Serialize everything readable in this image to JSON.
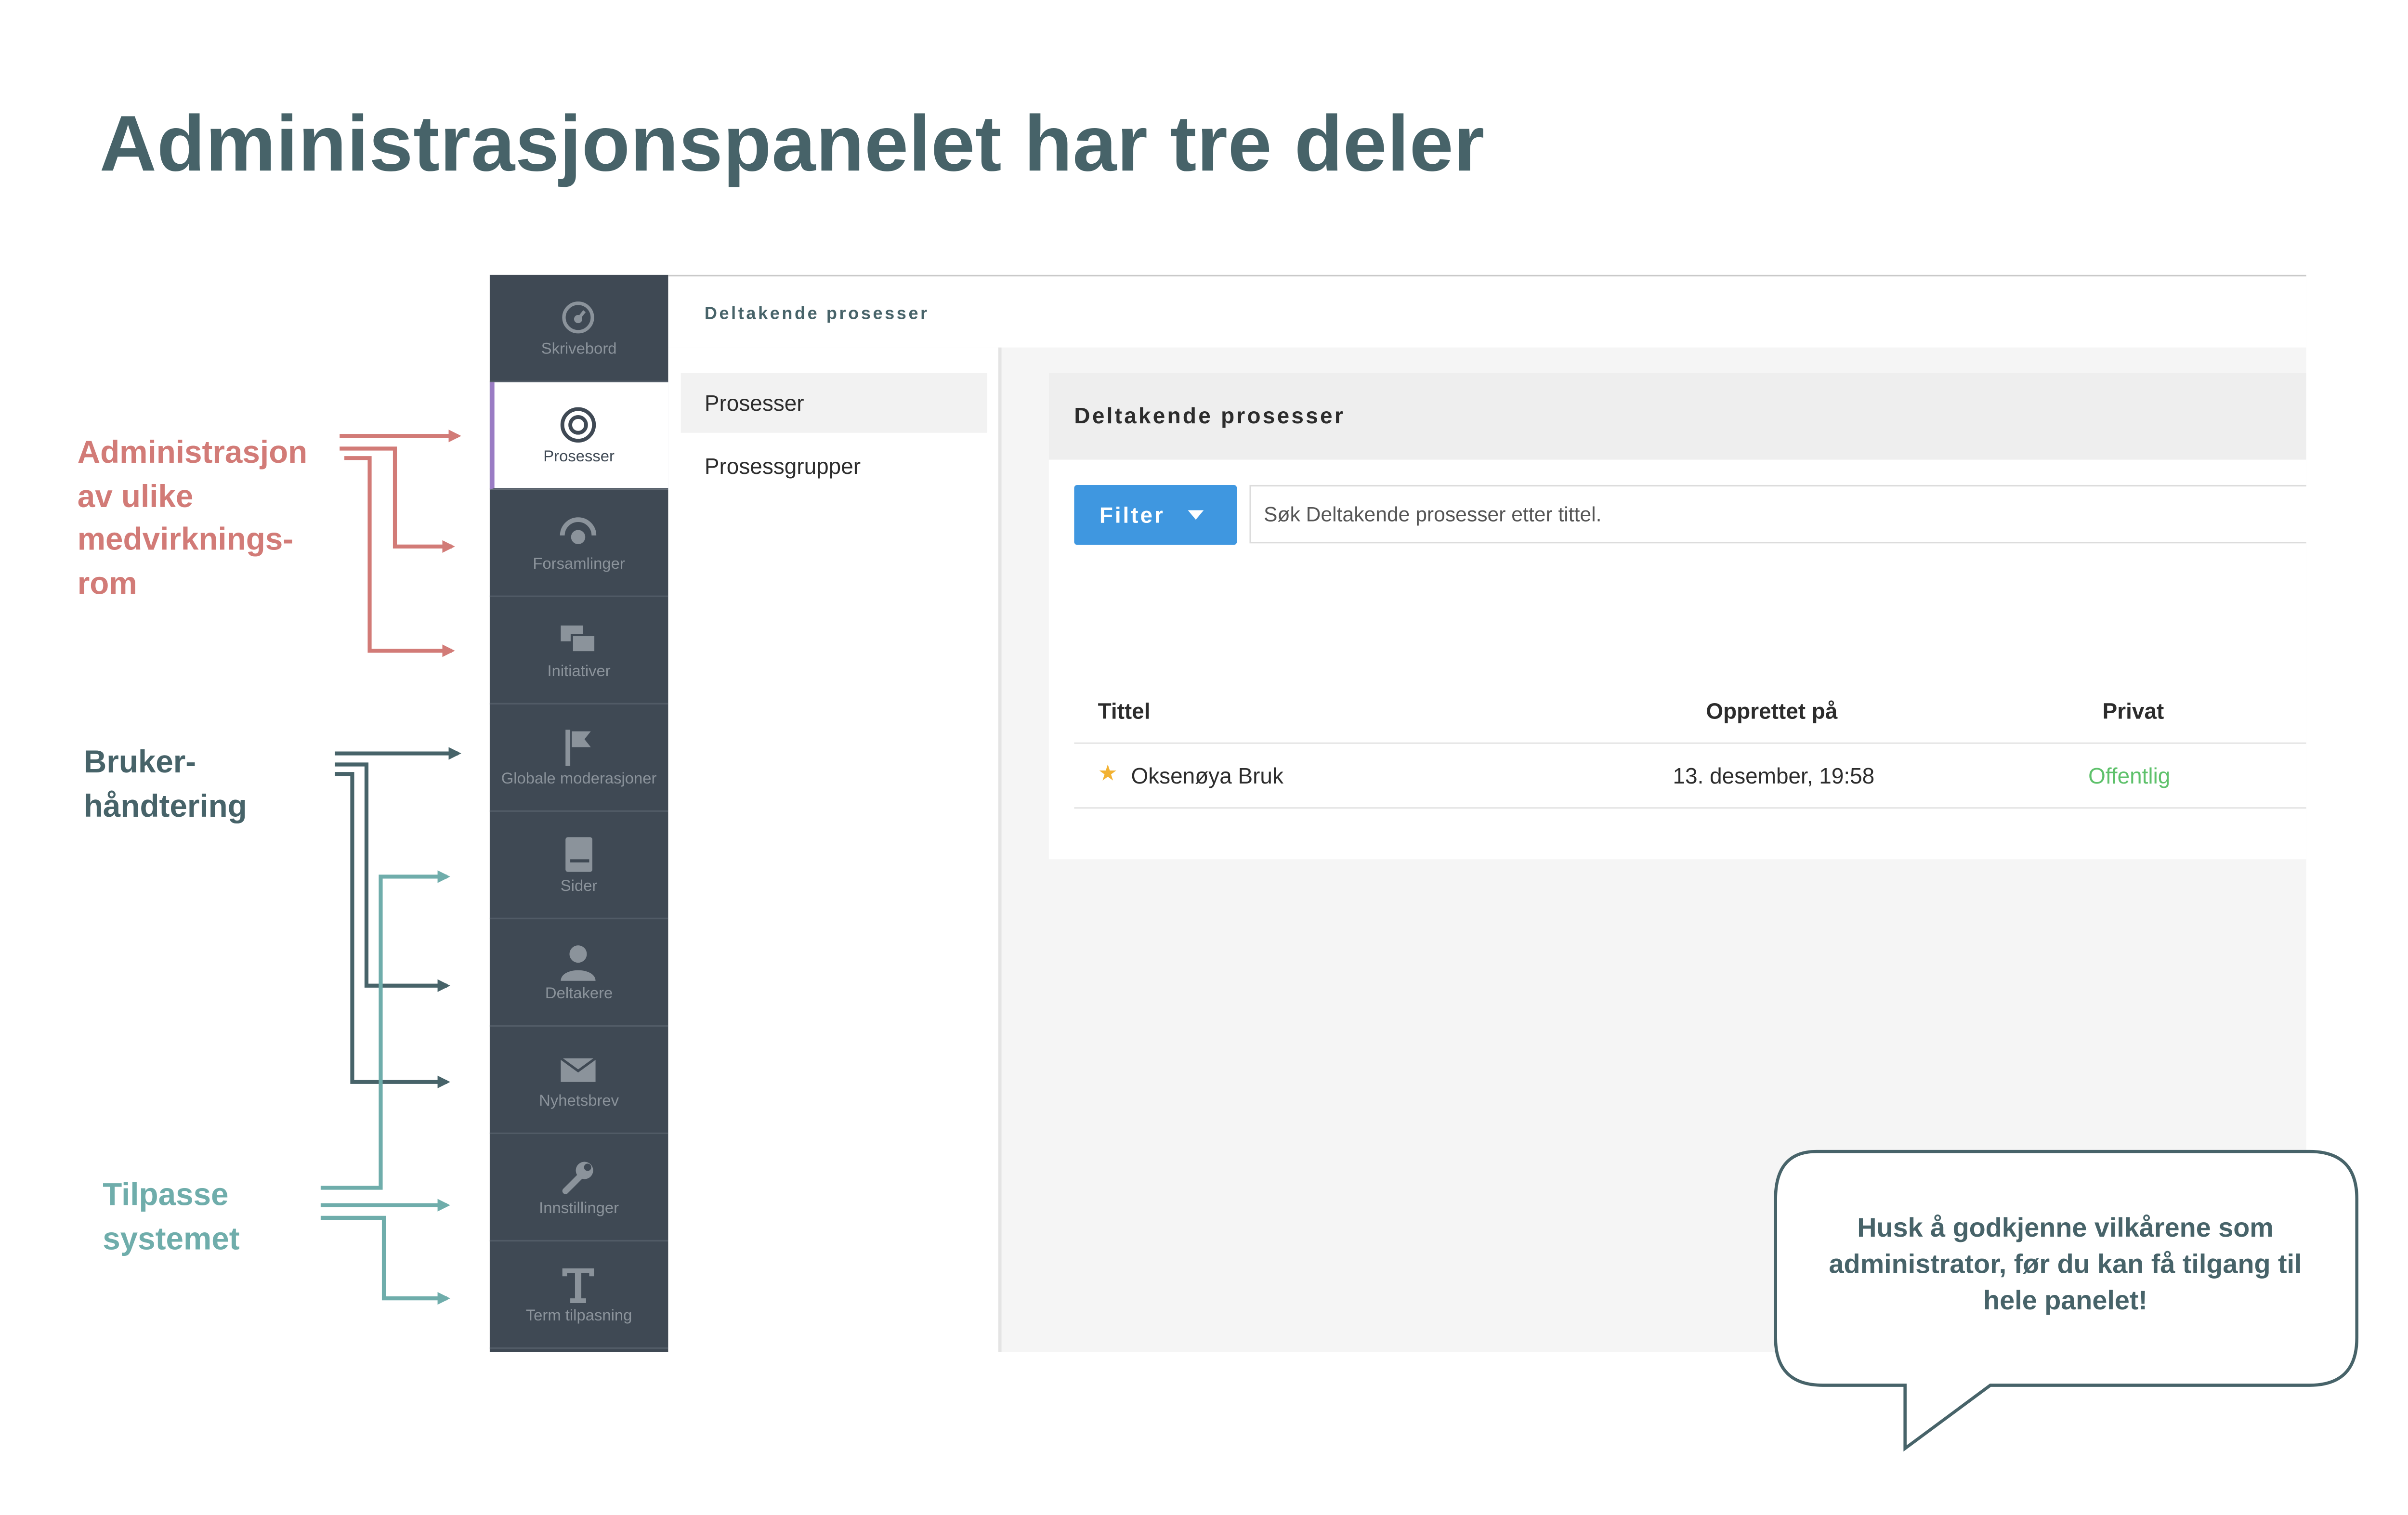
{
  "slide": {
    "title": "Administrasjonspanelet har tre deler"
  },
  "annotations": {
    "admin_rooms": [
      "Administrasjon",
      "av ulike",
      "medvirknings-",
      "rom"
    ],
    "user_handling": [
      "Bruker-",
      "håndtering"
    ],
    "customize": [
      "Tilpasse",
      "systemet"
    ],
    "colors": {
      "admin_rooms": "#d27b77",
      "user_handling": "#476369",
      "customize": "#6fadab"
    }
  },
  "sidebar": {
    "items": [
      {
        "label": "Skrivebord",
        "icon": "dashboard-icon"
      },
      {
        "label": "Prosesser",
        "icon": "target-icon",
        "active": true
      },
      {
        "label": "Forsamlinger",
        "icon": "assembly-icon"
      },
      {
        "label": "Initiativer",
        "icon": "chat-bubbles-icon"
      },
      {
        "label": "Globale moderasjoner",
        "icon": "flag-icon"
      },
      {
        "label": "Sider",
        "icon": "book-icon"
      },
      {
        "label": "Deltakere",
        "icon": "person-icon"
      },
      {
        "label": "Nyhetsbrev",
        "icon": "envelope-icon"
      },
      {
        "label": "Innstillinger",
        "icon": "wrench-icon"
      },
      {
        "label": "Term tilpasning",
        "icon": "text-t-icon"
      }
    ]
  },
  "header": {
    "title": "Deltakende prosesser"
  },
  "submenu": {
    "items": [
      {
        "label": "Prosesser",
        "active": true
      },
      {
        "label": "Prosessgrupper"
      }
    ]
  },
  "content": {
    "title": "Deltakende prosesser",
    "filter_label": "Filter",
    "search_placeholder": "Søk Deltakende prosesser etter tittel.",
    "table": {
      "headers": [
        "Tittel",
        "Opprettet på",
        "Privat"
      ],
      "rows": [
        {
          "title": "Oksenøya Bruk",
          "created": "13. desember, 19:58",
          "private": "Offentlig",
          "starred": true
        }
      ]
    }
  },
  "callout": {
    "lines": [
      "Husk å godkjenne vilkårene som",
      "administrator, før du kan få tilgang til",
      "hele panelet!"
    ]
  }
}
